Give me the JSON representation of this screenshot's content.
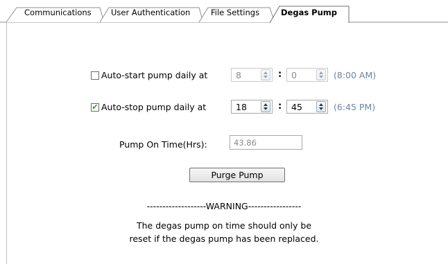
{
  "tabs": [
    {
      "label": "Communications",
      "active": false
    },
    {
      "label": "User Authentication",
      "active": false
    },
    {
      "label": "File Settings",
      "active": false
    },
    {
      "label": "Degas Pump",
      "active": true
    }
  ],
  "schedule": {
    "auto_start": {
      "label": "Auto-start pump daily at",
      "checked": false,
      "hour": "8",
      "minute": "0",
      "separator": ":",
      "time_display": "(8:00 AM)"
    },
    "auto_stop": {
      "label": "Auto-stop pump daily at",
      "checked": true,
      "hour": "18",
      "minute": "45",
      "separator": ":",
      "time_display": "(6:45 PM)"
    }
  },
  "pump_on_time": {
    "label": "Pump On Time(Hrs):",
    "value": "43.86"
  },
  "purge_button": {
    "label": "Purge Pump"
  },
  "warning": {
    "header": "-------------------WARNING-----------------",
    "line1": "The degas pump on time should only be",
    "line2": "reset if the degas pump has been replaced."
  },
  "colors": {
    "time_display": "#6d84a4",
    "check_mark": "#1aa31a",
    "disabled_text": "#8a8a8a"
  }
}
